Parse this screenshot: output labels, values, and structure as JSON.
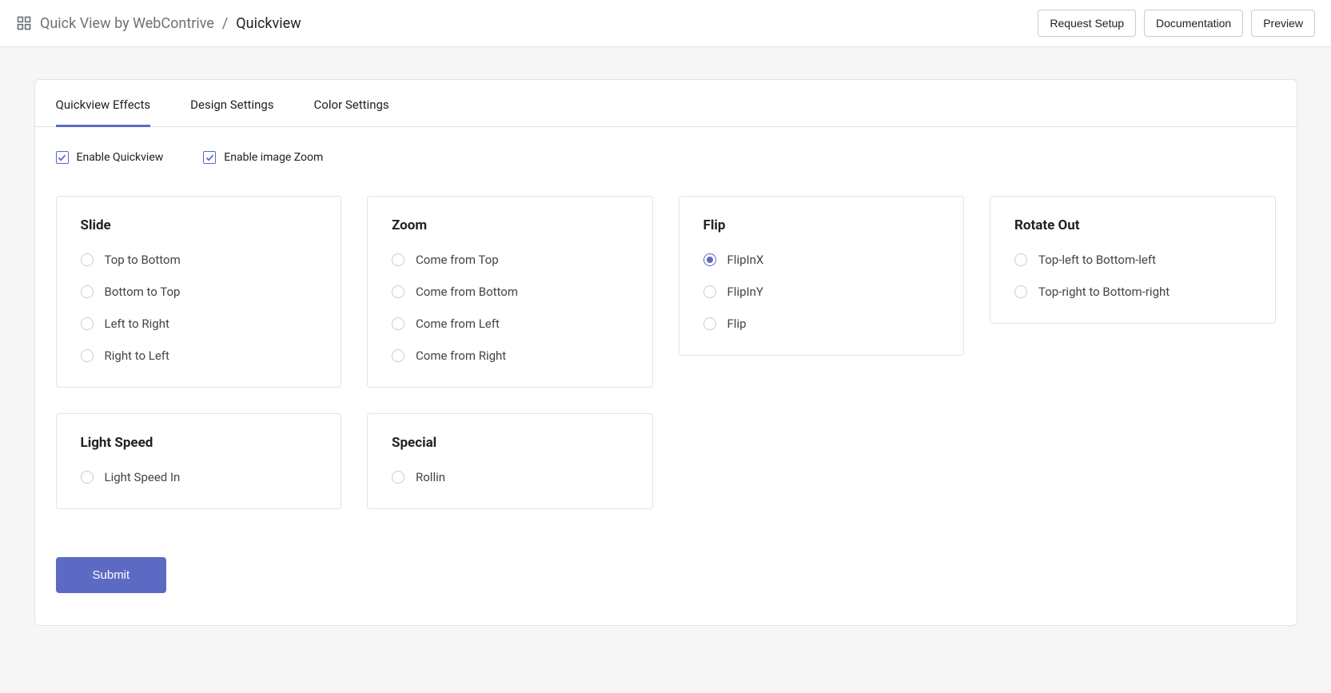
{
  "header": {
    "app_name": "Quick View by WebContrive",
    "separator": "/",
    "page_name": "Quickview",
    "buttons": {
      "request_setup": "Request Setup",
      "documentation": "Documentation",
      "preview": "Preview"
    }
  },
  "tabs": [
    {
      "label": "Quickview Effects",
      "active": true
    },
    {
      "label": "Design Settings",
      "active": false
    },
    {
      "label": "Color Settings",
      "active": false
    }
  ],
  "checkboxes": {
    "enable_quickview": {
      "label": "Enable Quickview",
      "checked": true
    },
    "enable_image_zoom": {
      "label": "Enable image Zoom",
      "checked": true
    }
  },
  "groups": [
    {
      "title": "Slide",
      "options": [
        {
          "label": "Top to Bottom",
          "selected": false
        },
        {
          "label": "Bottom to Top",
          "selected": false
        },
        {
          "label": "Left to Right",
          "selected": false
        },
        {
          "label": "Right to Left",
          "selected": false
        }
      ]
    },
    {
      "title": "Zoom",
      "options": [
        {
          "label": "Come from Top",
          "selected": false
        },
        {
          "label": "Come from Bottom",
          "selected": false
        },
        {
          "label": "Come from Left",
          "selected": false
        },
        {
          "label": "Come from Right",
          "selected": false
        }
      ]
    },
    {
      "title": "Flip",
      "options": [
        {
          "label": "FlipInX",
          "selected": true
        },
        {
          "label": "FlipInY",
          "selected": false
        },
        {
          "label": "Flip",
          "selected": false
        }
      ]
    },
    {
      "title": "Rotate Out",
      "options": [
        {
          "label": "Top-left to Bottom-left",
          "selected": false
        },
        {
          "label": "Top-right to Bottom-right",
          "selected": false
        }
      ]
    },
    {
      "title": "Light Speed",
      "options": [
        {
          "label": "Light Speed In",
          "selected": false
        }
      ]
    },
    {
      "title": "Special",
      "options": [
        {
          "label": "Rollin",
          "selected": false
        }
      ]
    }
  ],
  "submit_label": "Submit"
}
